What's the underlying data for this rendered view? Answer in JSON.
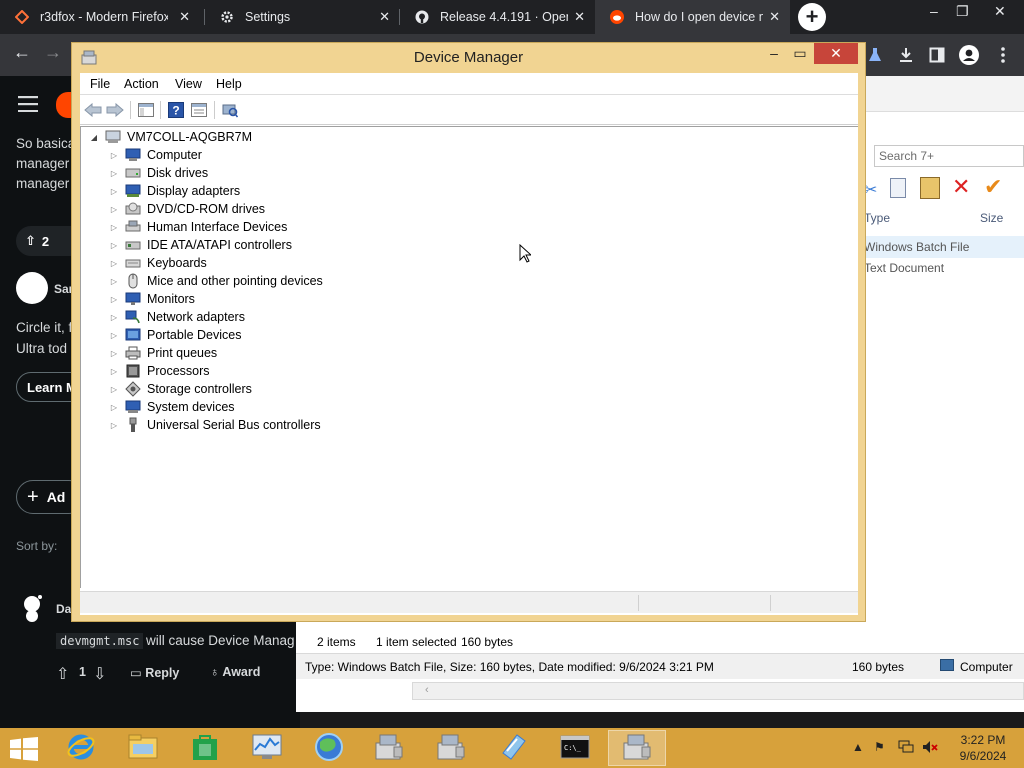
{
  "browser": {
    "tabs": [
      {
        "title": "r3dfox - Modern Firefox",
        "icon": "r3dfox-icon"
      },
      {
        "title": "Settings",
        "icon": "gear-icon"
      },
      {
        "title": "Release 4.4.191 · Open-",
        "icon": "github-icon"
      },
      {
        "title": "How do I open device m",
        "icon": "reddit-icon",
        "active": true
      }
    ],
    "new_tab_label": "+",
    "window_controls": {
      "minimize": "–",
      "restore": "❐",
      "close": "✕"
    }
  },
  "reddit": {
    "post_lines": [
      "So basica",
      "manager",
      "manager"
    ],
    "vote_count": "2",
    "commenter_1_initial": "Sar",
    "ad_lines": [
      "Circle it, f",
      "Ultra tod"
    ],
    "learn_more": "Learn M",
    "add_comment": "Ad",
    "sort_by": "Sort by:",
    "commenter_2_initial": "Da",
    "comment_code": "devmgmt.msc",
    "comment_text": "will cause Device Manag",
    "comment_votes": "1",
    "reply": "Reply",
    "award": "Award"
  },
  "explorer": {
    "search_placeholder": "Search 7+",
    "col_type": "Type",
    "col_size": "Size",
    "row1_type": "Windows Batch File",
    "row2_type": "Text Document",
    "items_count": "2 items",
    "selected": "1 item selected",
    "selected_size": "160 bytes",
    "details": "Type: Windows Batch File, Size: 160 bytes, Date modified: 9/6/2024 3:21 PM",
    "details_size": "160 bytes",
    "details_location": "Computer"
  },
  "device_manager": {
    "title": "Device Manager",
    "menus": [
      "File",
      "Action",
      "View",
      "Help"
    ],
    "root": "VM7COLL-AQGBR7M",
    "categories": [
      {
        "label": "Computer",
        "icon": "computer-icon"
      },
      {
        "label": "Disk drives",
        "icon": "disk-drive-icon"
      },
      {
        "label": "Display adapters",
        "icon": "display-adapter-icon"
      },
      {
        "label": "DVD/CD-ROM drives",
        "icon": "dvd-drive-icon"
      },
      {
        "label": "Human Interface Devices",
        "icon": "hid-icon"
      },
      {
        "label": "IDE ATA/ATAPI controllers",
        "icon": "ide-controller-icon"
      },
      {
        "label": "Keyboards",
        "icon": "keyboard-icon"
      },
      {
        "label": "Mice and other pointing devices",
        "icon": "mouse-icon"
      },
      {
        "label": "Monitors",
        "icon": "monitor-icon"
      },
      {
        "label": "Network adapters",
        "icon": "network-adapter-icon"
      },
      {
        "label": "Portable Devices",
        "icon": "portable-device-icon"
      },
      {
        "label": "Print queues",
        "icon": "printer-icon"
      },
      {
        "label": "Processors",
        "icon": "processor-icon"
      },
      {
        "label": "Storage controllers",
        "icon": "storage-controller-icon"
      },
      {
        "label": "System devices",
        "icon": "system-device-icon"
      },
      {
        "label": "Universal Serial Bus controllers",
        "icon": "usb-icon"
      }
    ]
  },
  "taskbar": {
    "time": "3:22 PM",
    "date": "9/6/2024"
  },
  "colors": {
    "dm_frame": "#f1d492",
    "taskbar": "#d7a13b",
    "browser_dark": "#202124",
    "reddit_orange": "#ff4500"
  }
}
